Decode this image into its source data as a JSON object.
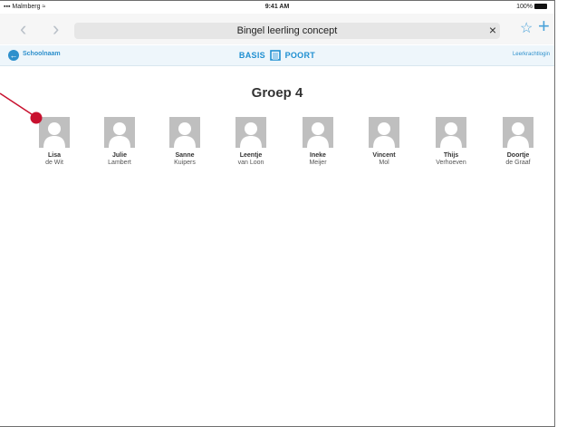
{
  "status_bar": {
    "carrier": "Malmberg",
    "time": "9:41 AM",
    "battery": "100%"
  },
  "browser": {
    "url_title": "Bingel leerling concept",
    "back_icon": "chevron-left-icon",
    "forward_icon": "chevron-right-icon",
    "clear_icon": "close-icon",
    "bookmark_icon": "star-icon",
    "new_tab_icon": "plus-icon"
  },
  "app_bar": {
    "back_label": "Schoolnaam",
    "logo_left": "BASIS",
    "logo_right": "POORT",
    "teacher_login": "Leerkrachtlogin"
  },
  "group": {
    "title": "Groep 4"
  },
  "students": [
    {
      "first": "Lisa",
      "last": "de Wit"
    },
    {
      "first": "Julie",
      "last": "Lambert"
    },
    {
      "first": "Sanne",
      "last": "Kuipers"
    },
    {
      "first": "Leentje",
      "last": "van Loon"
    },
    {
      "first": "Ineke",
      "last": "Meijer"
    },
    {
      "first": "Vincent",
      "last": "Mol"
    },
    {
      "first": "Thijs",
      "last": "Verhoeven"
    },
    {
      "first": "Doortje",
      "last": "de Graaf"
    }
  ],
  "colors": {
    "accent": "#2e90cc",
    "annotation": "#c8102e",
    "avatar_bg": "#bfbfbf"
  }
}
